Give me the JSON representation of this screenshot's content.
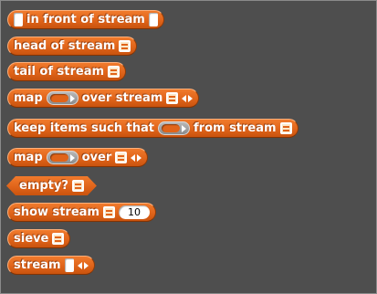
{
  "palette": {
    "accent_color": "#e0641a",
    "blocks": [
      {
        "id": "in-front-of-stream",
        "label": "in front of stream"
      },
      {
        "id": "head-of-stream",
        "label": "head of stream"
      },
      {
        "id": "tail-of-stream",
        "label": "tail of stream"
      },
      {
        "id": "map-over-stream",
        "label_a": "map",
        "label_b": "over stream"
      },
      {
        "id": "keep-items",
        "label_a": "keep items such that",
        "label_b": "from stream"
      },
      {
        "id": "map-over",
        "label_a": "map",
        "label_b": "over"
      },
      {
        "id": "empty",
        "label": "empty?"
      },
      {
        "id": "show-stream",
        "label": "show stream",
        "value": "10"
      },
      {
        "id": "sieve",
        "label": "sieve"
      },
      {
        "id": "stream",
        "label": "stream"
      }
    ]
  }
}
